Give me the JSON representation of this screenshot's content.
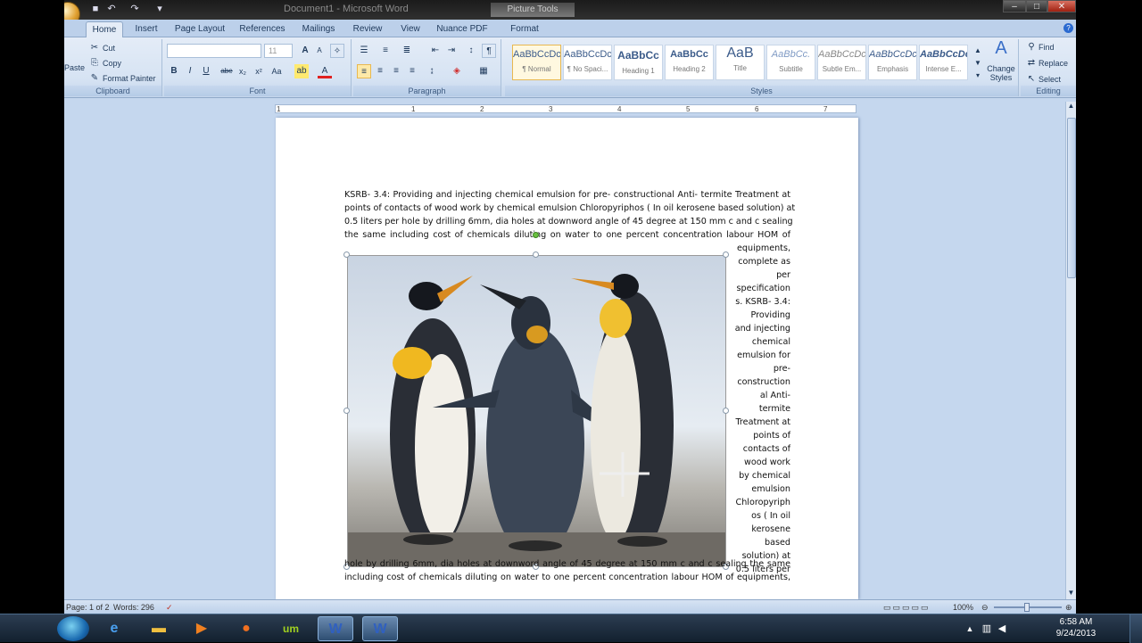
{
  "window": {
    "doc_title": "Document1 - Microsoft Word",
    "context_tab": "Picture Tools",
    "minimize": "–",
    "maximize": "□",
    "close": "✕"
  },
  "tabs": [
    "Home",
    "Insert",
    "Page Layout",
    "References",
    "Mailings",
    "Review",
    "View",
    "Nuance PDF",
    "Format"
  ],
  "ribbon": {
    "clipboard": {
      "paste": "Paste",
      "cut": "Cut",
      "copy": "Copy",
      "format_painter": "Format Painter",
      "label": "Clipboard"
    },
    "font": {
      "font_size": "11",
      "label": "Font",
      "bold": "B",
      "italic": "I",
      "underline": "U",
      "strike": "abe",
      "subscript": "x₂",
      "superscript": "x²",
      "grow": "A",
      "shrink": "A"
    },
    "paragraph": {
      "label": "Paragraph",
      "pilcrow": "¶"
    },
    "styles": {
      "label": "Styles",
      "tiles": [
        {
          "sample": "AaBbCcDc",
          "name": "¶ Normal"
        },
        {
          "sample": "AaBbCcDc",
          "name": "¶ No Spaci..."
        },
        {
          "sample": "AaBbCc",
          "name": "Heading 1"
        },
        {
          "sample": "AaBbCc",
          "name": "Heading 2"
        },
        {
          "sample": "AaB",
          "name": "Title"
        },
        {
          "sample": "AaBbCc.",
          "name": "Subtitle"
        },
        {
          "sample": "AaBbCcDc",
          "name": "Subtle Em..."
        },
        {
          "sample": "AaBbCcDc",
          "name": "Emphasis"
        },
        {
          "sample": "AaBbCcDc",
          "name": "Intense E..."
        }
      ],
      "change_styles": "Change Styles"
    },
    "editing": {
      "find": "Find",
      "replace": "Replace",
      "select": "Select",
      "label": "Editing"
    }
  },
  "ruler_numbers": [
    "1",
    "1",
    "2",
    "3",
    "4",
    "5",
    "6",
    "7"
  ],
  "document": {
    "para1_lines": [
      "KSRB- 3.4: Providing and injecting chemical emulsion for pre- constructional Anti- termite Treatment at",
      "points of contacts of wood work by chemical emulsion Chloropyriphos ( In oil kerosene based solution) at",
      "0.5 liters per hole by drilling 6mm, dia holes at downword angle of 45 degree at 150 mm c and c sealing",
      "the same including cost of chemicals diluting on water to one percent concentration labour HOM of"
    ],
    "wrap_lines": [
      "equipments,",
      "complete as",
      "per",
      "specification",
      "s. KSRB- 3.4:",
      "Providing",
      "and injecting",
      "chemical",
      "emulsion for",
      "pre-",
      "construction",
      "al Anti-",
      "termite",
      "Treatment at",
      "points of",
      "contacts of",
      "wood work",
      "by chemical",
      "emulsion",
      "Chloropyriph",
      "os ( In oil",
      "kerosene",
      "based",
      "solution) at",
      "0.5 liters per"
    ],
    "para2_lines": [
      "hole by drilling 6mm, dia holes at downword angle of 45 degree at 150 mm c and c sealing the same",
      "including cost of chemicals diluting on water to one percent concentration labour HOM of equipments,"
    ]
  },
  "status": {
    "page": "Page: 1 of 2",
    "words": "Words: 296",
    "zoom": "100%"
  },
  "taskbar": {
    "icons": [
      "start-orb-icon",
      "internet-explorer-icon",
      "folder-icon",
      "media-player-icon",
      "firefox-icon",
      "ultra-media-icon",
      "word-document-icon",
      "word-icon"
    ],
    "time": "6:58 AM",
    "date": "9/24/2013"
  }
}
